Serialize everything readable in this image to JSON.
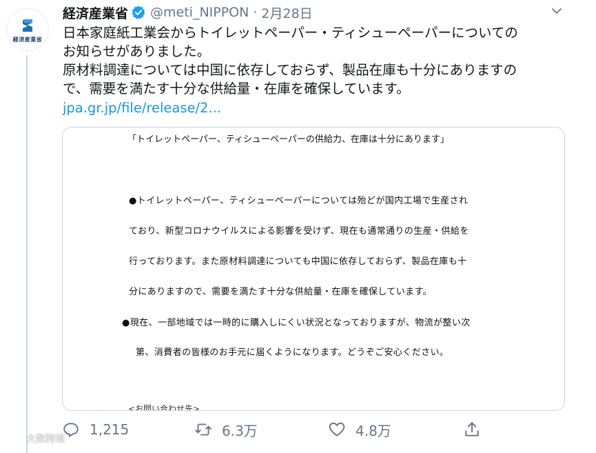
{
  "account": {
    "display_name": "経済産業省",
    "handle": "@meti_NIPPON",
    "separator": "·",
    "date": "2月28日",
    "avatar_text": "経済産業省",
    "verified_icon": "verified-badge-icon",
    "brand_color": "#1d3f7a"
  },
  "tweet": {
    "line1": "日本家庭紙工業会からトイレットペーパー・ティシューペーパーについての",
    "line2": "お知らせがありました。",
    "line3": "原材料調達については中国に依存しておらず、製品在庫も十分にありますの",
    "line4": "で、需要を満たす十分な供給量・在庫を確保しています。",
    "link": "jpa.gr.jp/file/release/2..."
  },
  "card": {
    "title": "「トイレットペーパー、ティシューペーパーの供給力、在庫は十分にあります」",
    "lines": [
      "●トイレットペーパー、ティシューペーパーについては殆どが国内工場で生産され",
      "ており、新型コロナウイルスによる影響を受けず、現在も通常通りの生産・供給を",
      "行っております。また原材料調達についても中国に依存しておらず、製品在庫も十",
      "分にありますので、需要を満たす十分な供給量・在庫を確保しています。",
      "●現在、一部地域では一時的に購入しにくい状況となっておりますが、物流が整い次",
      "第、消費者の皆様のお手元に届くようになります。どうぞご安心ください。"
    ],
    "contact": "<お問い合わせ先>"
  },
  "actions": {
    "reply_count": "1,215",
    "retweet_count": "6.3万",
    "like_count": "4.8万",
    "reply_icon": "reply-icon",
    "retweet_icon": "retweet-icon",
    "like_icon": "heart-icon",
    "share_icon": "share-icon",
    "accent_color": "#657786"
  },
  "watermark": {
    "text": "大数跨境"
  }
}
